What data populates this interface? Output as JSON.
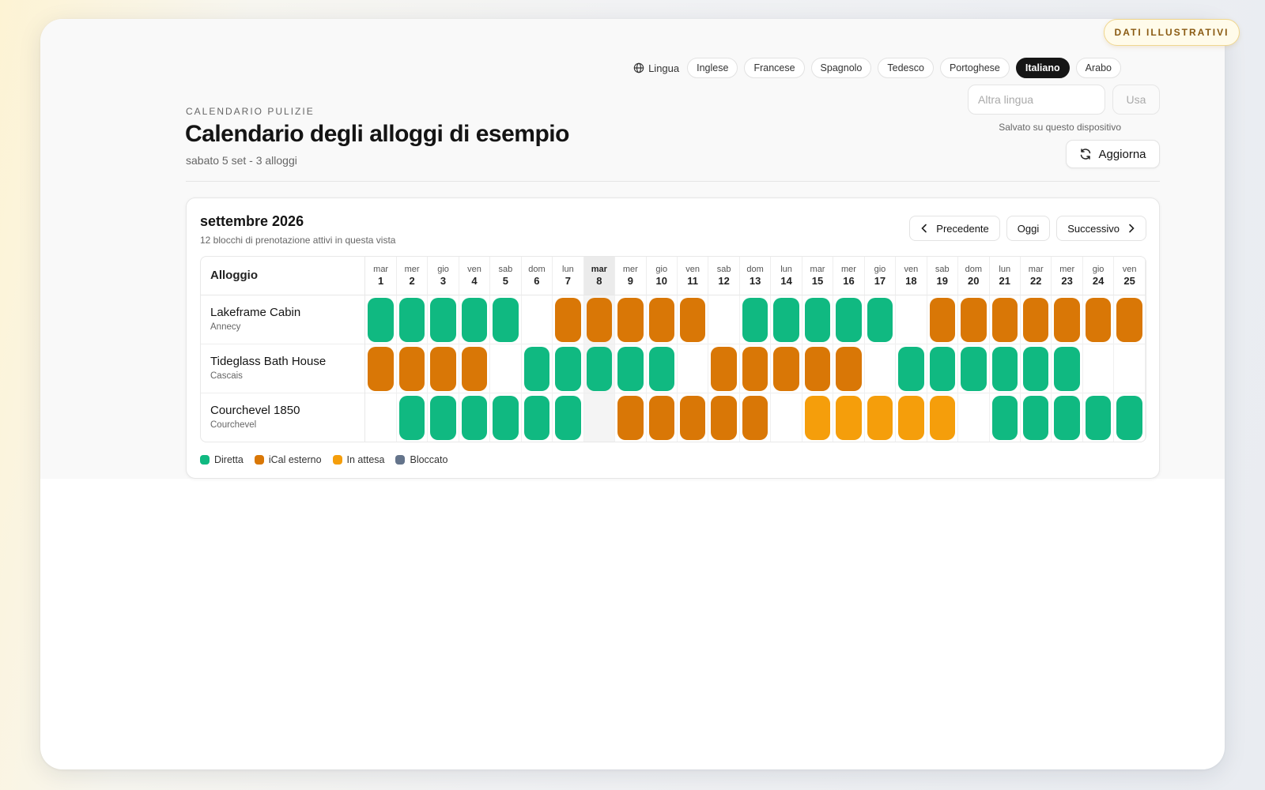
{
  "badge": "DATI ILLUSTRATIVI",
  "language": {
    "label": "Lingua",
    "options": [
      "Inglese",
      "Francese",
      "Spagnolo",
      "Tedesco",
      "Portoghese",
      "Italiano",
      "Arabo"
    ],
    "active": "Italiano",
    "other_placeholder": "Altra lingua",
    "use_label": "Usa",
    "saved_note": "Salvato su questo dispositivo"
  },
  "header": {
    "eyebrow": "CALENDARIO PULIZIE",
    "title": "Calendario degli alloggi di esempio",
    "subtitle": "sabato 5 set - 3 alloggi",
    "refresh_label": "Aggiorna"
  },
  "calendar": {
    "month": "settembre 2026",
    "summary": "12 blocchi di prenotazione attivi in questa vista",
    "nav": {
      "prev": "Precedente",
      "today": "Oggi",
      "next": "Successivo"
    },
    "property_header": "Alloggio",
    "today_index": 7,
    "days": [
      {
        "n": "mar",
        "d": "1"
      },
      {
        "n": "mer",
        "d": "2"
      },
      {
        "n": "gio",
        "d": "3"
      },
      {
        "n": "ven",
        "d": "4"
      },
      {
        "n": "sab",
        "d": "5"
      },
      {
        "n": "dom",
        "d": "6"
      },
      {
        "n": "lun",
        "d": "7"
      },
      {
        "n": "mar",
        "d": "8"
      },
      {
        "n": "mer",
        "d": "9"
      },
      {
        "n": "gio",
        "d": "10"
      },
      {
        "n": "ven",
        "d": "11"
      },
      {
        "n": "sab",
        "d": "12"
      },
      {
        "n": "dom",
        "d": "13"
      },
      {
        "n": "lun",
        "d": "14"
      },
      {
        "n": "mar",
        "d": "15"
      },
      {
        "n": "mer",
        "d": "16"
      },
      {
        "n": "gio",
        "d": "17"
      },
      {
        "n": "ven",
        "d": "18"
      },
      {
        "n": "sab",
        "d": "19"
      },
      {
        "n": "dom",
        "d": "20"
      },
      {
        "n": "lun",
        "d": "21"
      },
      {
        "n": "mar",
        "d": "22"
      },
      {
        "n": "mer",
        "d": "23"
      },
      {
        "n": "gio",
        "d": "24"
      },
      {
        "n": "ven",
        "d": "25"
      }
    ],
    "status_colors": {
      "D": "#10b981",
      "I": "#d97706",
      "A": "#f59e0b",
      "B": "#64748b"
    },
    "properties": [
      {
        "name": "Lakeframe Cabin",
        "city": "Annecy",
        "cells": [
          "D",
          "D",
          "D",
          "D",
          "D",
          "",
          "I",
          "I",
          "I",
          "I",
          "I",
          "",
          "D",
          "D",
          "D",
          "D",
          "D",
          "",
          "I",
          "I",
          "I",
          "I",
          "I",
          "I",
          "I"
        ]
      },
      {
        "name": "Tideglass Bath House",
        "city": "Cascais",
        "cells": [
          "I",
          "I",
          "I",
          "I",
          "",
          "D",
          "D",
          "D",
          "D",
          "D",
          "",
          "I",
          "I",
          "I",
          "I",
          "I",
          "",
          "D",
          "D",
          "D",
          "D",
          "D",
          "D",
          "",
          ""
        ]
      },
      {
        "name": "Courchevel 1850",
        "city": "Courchevel",
        "cells": [
          "",
          "D",
          "D",
          "D",
          "D",
          "D",
          "D",
          "",
          "I",
          "I",
          "I",
          "I",
          "I",
          "",
          "A",
          "A",
          "A",
          "A",
          "A",
          "",
          "D",
          "D",
          "D",
          "D",
          "D"
        ]
      }
    ],
    "legend": [
      {
        "label": "Diretta",
        "color": "#10b981"
      },
      {
        "label": "iCal esterno",
        "color": "#d97706"
      },
      {
        "label": "In attesa",
        "color": "#f59e0b"
      },
      {
        "label": "Bloccato",
        "color": "#64748b"
      }
    ]
  }
}
